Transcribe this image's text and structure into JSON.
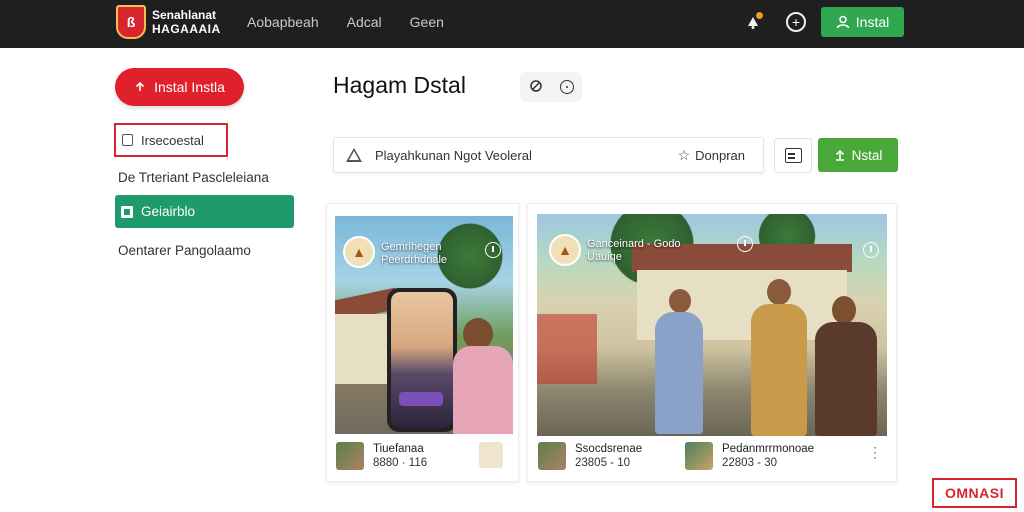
{
  "header": {
    "logo_line1": "Senahlanat",
    "logo_line2": "HAGAAAIA",
    "logo_glyph": "ß",
    "nav": [
      "Aobapbeah",
      "Adcal",
      "Geen"
    ],
    "install_label": "Instal",
    "icons": [
      "bell-icon",
      "plus-circle-icon",
      "user-icon"
    ]
  },
  "sidebar": {
    "install_label": "Instal Instla",
    "items": [
      {
        "label": "Irsecoestal"
      },
      {
        "label": "De Trteriant Pascleleiana"
      },
      {
        "label": "Geiairblo"
      },
      {
        "label": "Oentarer Pangolaamo"
      }
    ]
  },
  "main": {
    "title": "Hagam Dstal",
    "search_placeholder": "Playahkunan Ngot Veoleral",
    "favorite_label": "Donpran",
    "install_label": "Nstal"
  },
  "cards": [
    {
      "caption_line1": "Gemrlhegen",
      "caption_line2": "Peerdrhdnale",
      "meta_title": "Tiuefanaa",
      "meta_sub": "8880 · 116"
    },
    {
      "caption_line1": "Ganceinard - Godo",
      "caption_line2": "Uauiqe",
      "meta1_title": "Ssocdsrenae",
      "meta1_sub": "23805 - 10",
      "meta2_title": "Pedanmrrmonoae",
      "meta2_sub": "22803 - 30"
    }
  ],
  "badge": "OMNASI",
  "colors": {
    "topbar": "#1f1f1f",
    "brand_red": "#e0202b",
    "install_green": "#2fa84f",
    "active_green": "#1e9a6c",
    "button_green": "#4aa83a"
  }
}
